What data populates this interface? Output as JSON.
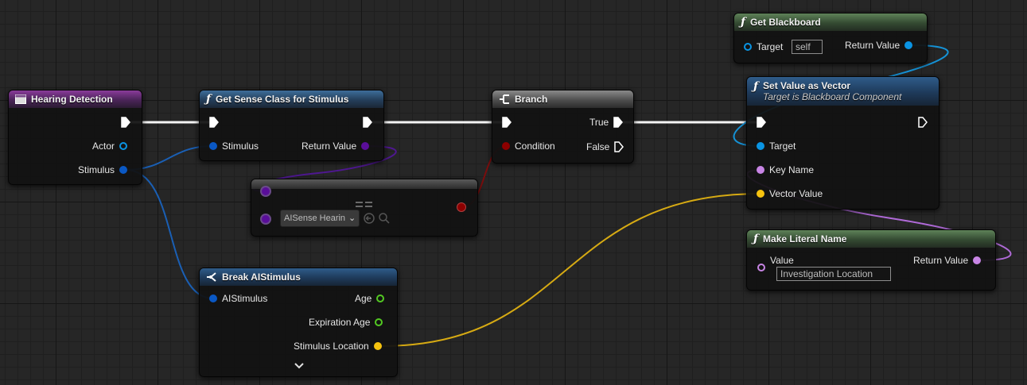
{
  "colors": {
    "exec": "#ffffff",
    "object": "#0a94e3",
    "struct": "#0a58c4",
    "class": "#5a0e9a",
    "bool": "#8c0000",
    "name": "#c885e5",
    "vector": "#f6c30f",
    "float": "#53c922"
  },
  "nodes": {
    "hearing_detection": {
      "title": "Hearing Detection",
      "icon": "event-icon",
      "pins": {
        "actor": "Actor",
        "stimulus": "Stimulus"
      }
    },
    "get_sense_class": {
      "title": "Get Sense Class for Stimulus",
      "icon": "function-icon",
      "pins": {
        "stimulus": "Stimulus",
        "return_value": "Return Value"
      }
    },
    "branch": {
      "title": "Branch",
      "icon": "branch-icon",
      "pins": {
        "condition": "Condition",
        "true_label": "True",
        "false_label": "False"
      }
    },
    "get_blackboard": {
      "title": "Get Blackboard",
      "icon": "function-icon",
      "pins": {
        "target": "Target",
        "target_value": "self",
        "return_value": "Return Value"
      }
    },
    "set_value_as_vector": {
      "title": "Set Value as Vector",
      "subtitle": "Target is Blackboard Component",
      "icon": "function-icon",
      "pins": {
        "target": "Target",
        "key_name": "Key Name",
        "vector_value": "Vector Value"
      }
    },
    "make_literal_name": {
      "title": "Make Literal Name",
      "icon": "function-icon",
      "pins": {
        "value": "Value",
        "value_literal": "Investigation Location",
        "return_value": "Return Value"
      }
    },
    "equal_class": {
      "select_value": "AISense Hearin",
      "icon": "equal-icon"
    },
    "break_aistimulus": {
      "title": "Break AIStimulus",
      "icon": "break-struct-icon",
      "pins": {
        "aistimulus": "AIStimulus",
        "age": "Age",
        "expiration_age": "Expiration Age",
        "stimulus_location": "Stimulus Location"
      }
    }
  }
}
